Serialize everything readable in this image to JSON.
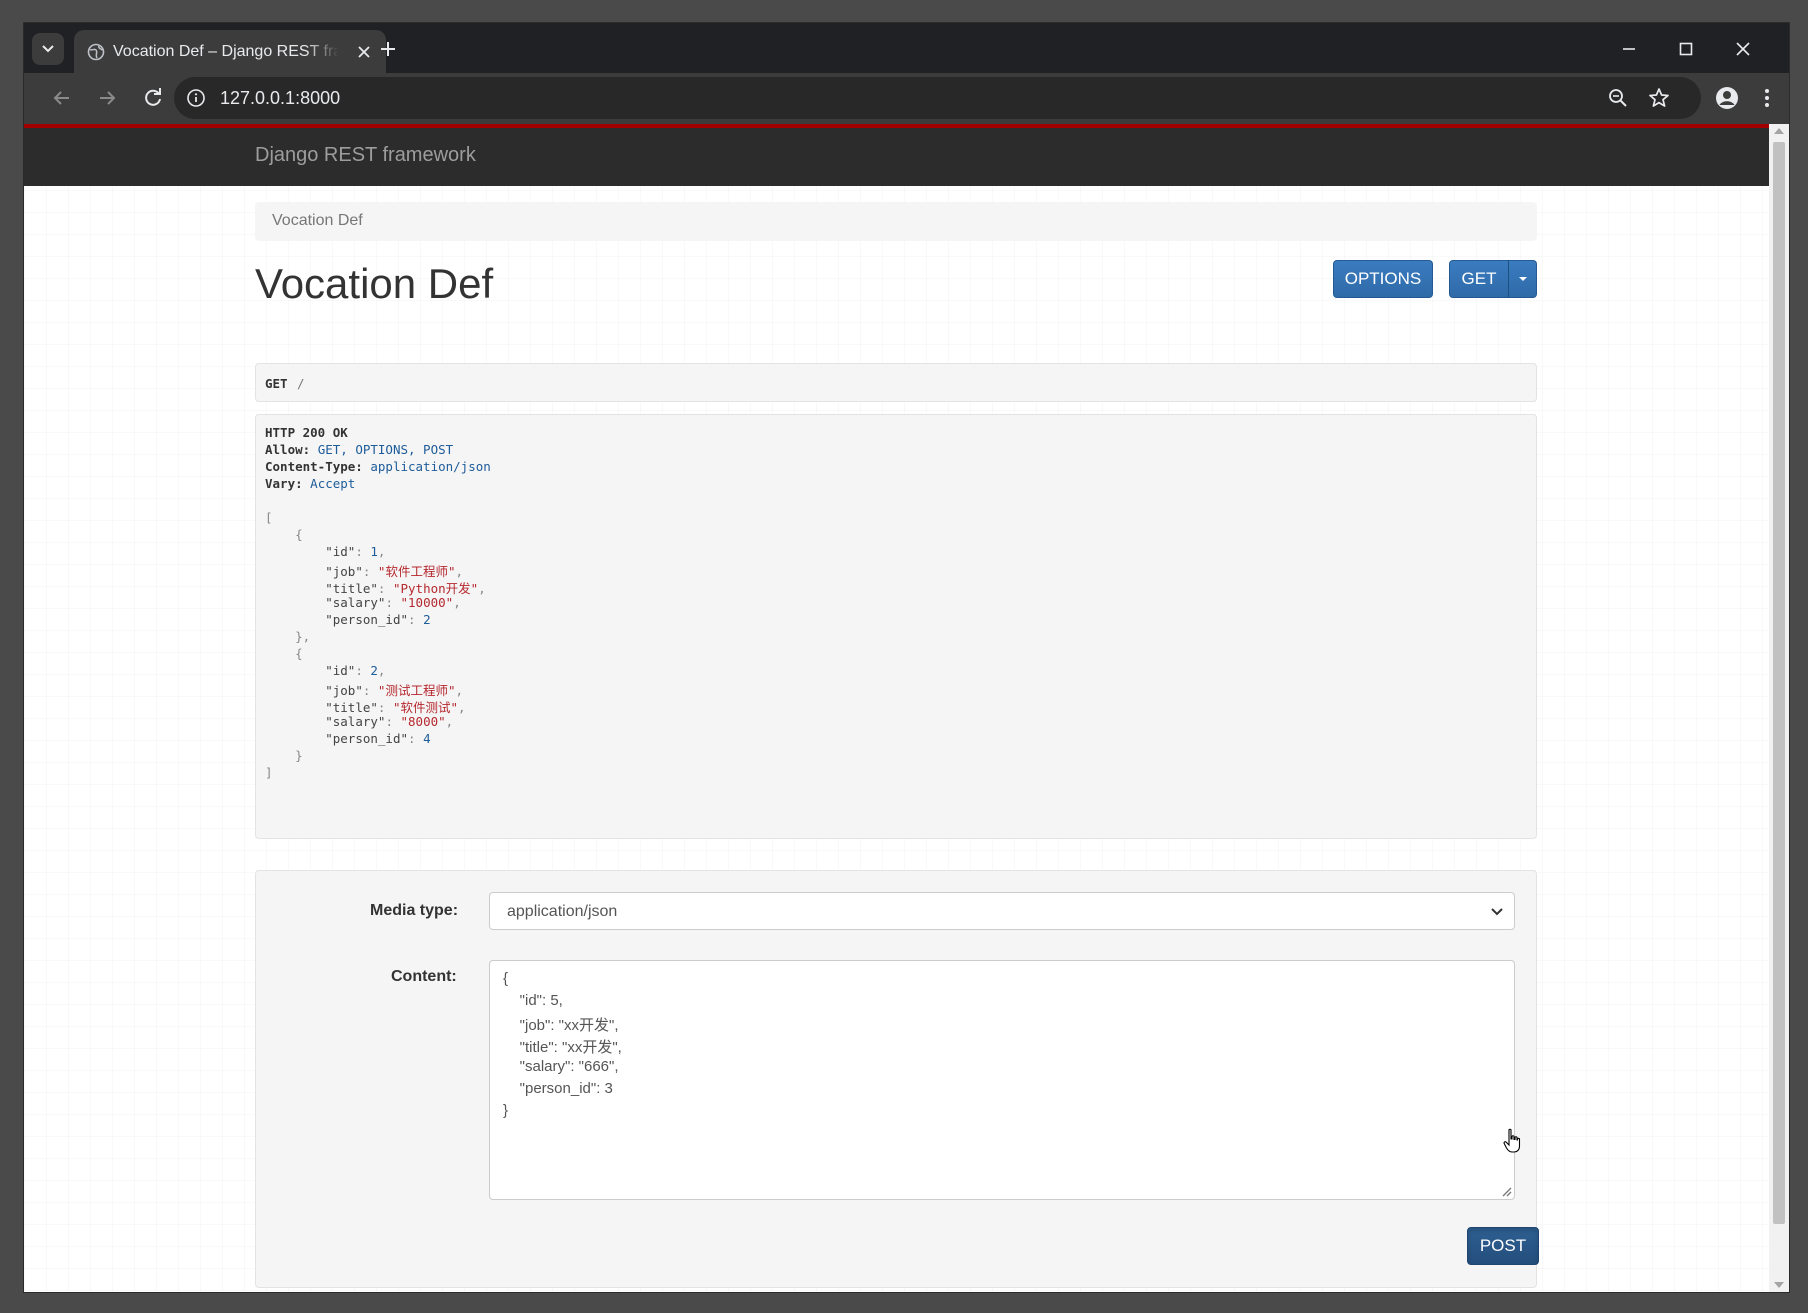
{
  "browser": {
    "tab_title": "Vocation Def – Django REST framework",
    "url": "127.0.0.1:8000"
  },
  "page": {
    "brand": "Django REST framework",
    "breadcrumb": "Vocation Def",
    "heading": "Vocation Def",
    "buttons": {
      "options": "OPTIONS",
      "get": "GET",
      "post": "POST"
    },
    "request": {
      "method": "GET",
      "path": "/"
    },
    "response": {
      "status": "HTTP 200 OK",
      "headers": [
        {
          "key": "Allow:",
          "value": "GET, OPTIONS, POST"
        },
        {
          "key": "Content-Type:",
          "value": "application/json"
        },
        {
          "key": "Vary:",
          "value": "Accept"
        }
      ],
      "records": [
        {
          "id": "1",
          "job": "\"软件工程师\"",
          "title": "\"Python开发\"",
          "salary": "\"10000\"",
          "person_id": "2"
        },
        {
          "id": "2",
          "job": "\"测试工程师\"",
          "title": "\"软件测试\"",
          "salary": "\"8000\"",
          "person_id": "4"
        }
      ]
    },
    "form": {
      "media_type_label": "Media type:",
      "media_type_value": "application/json",
      "content_label": "Content:",
      "content_lines": [
        "{",
        "    \"id\": 5,",
        "    \"job\": \"xx开发\",",
        "    \"title\": \"xx开发\",",
        "    \"salary\": \"666\",",
        "    \"person_id\": 3",
        "}"
      ]
    }
  },
  "colors": {
    "accent_red": "#a30000",
    "button_blue": "#2f6aa8",
    "navbar": "#2c2c2c"
  }
}
